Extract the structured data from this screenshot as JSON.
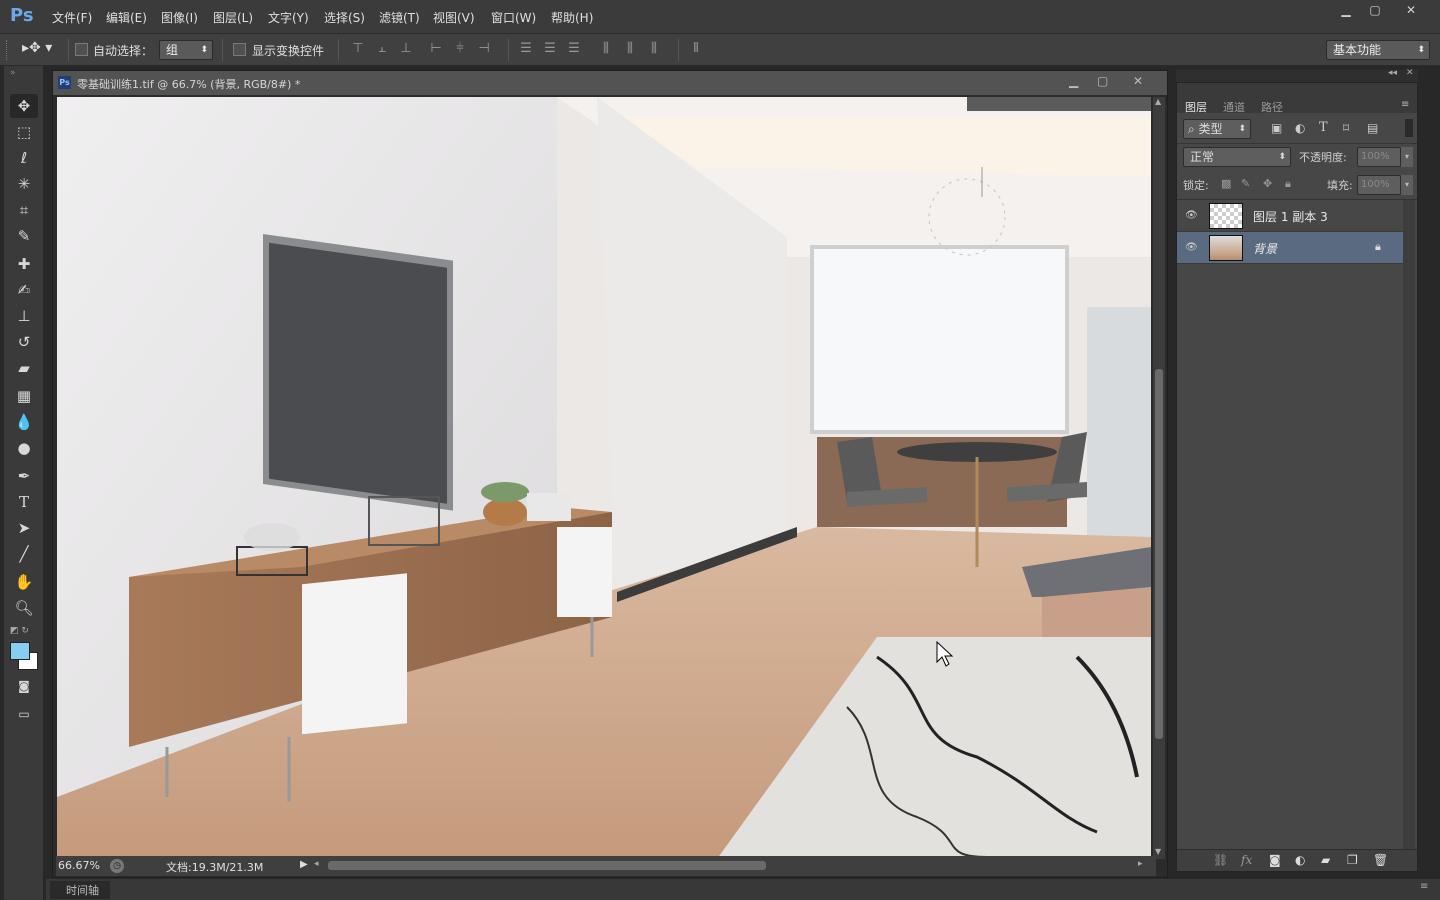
{
  "app": {
    "logo": "Ps",
    "menu": [
      "文件(F)",
      "编辑(E)",
      "图像(I)",
      "图层(L)",
      "文字(Y)",
      "选择(S)",
      "滤镜(T)",
      "视图(V)",
      "窗口(W)",
      "帮助(H)"
    ],
    "window_controls": [
      "minimize",
      "maximize",
      "close"
    ]
  },
  "options": {
    "auto_select_label": "自动选择：",
    "auto_select_value": "组",
    "show_transform_label": "显示变换控件",
    "workspace": "基本功能"
  },
  "document": {
    "title": "零基础训练1.tif @ 66.7% (背景, RGB/8#) *",
    "zoom": "66.67%",
    "doc_size": "文档:19.3M/21.3M"
  },
  "layers_panel": {
    "tabs": [
      "图层",
      "通道",
      "路径"
    ],
    "filter_label": "类型",
    "blend_mode": "正常",
    "opacity_label": "不透明度:",
    "opacity_value": "100%",
    "lock_label": "锁定:",
    "fill_label": "填充:",
    "fill_value": "100%",
    "layers": [
      {
        "name": "图层 1 副本 3",
        "visible": true,
        "selected": false
      },
      {
        "name": "背景",
        "visible": true,
        "selected": true,
        "locked": true
      }
    ]
  },
  "timeline": {
    "label": "时间轴"
  },
  "colors": {
    "foreground": "#87cdf3",
    "background": "#ffffff",
    "selected_layer": "#5a6a80"
  }
}
